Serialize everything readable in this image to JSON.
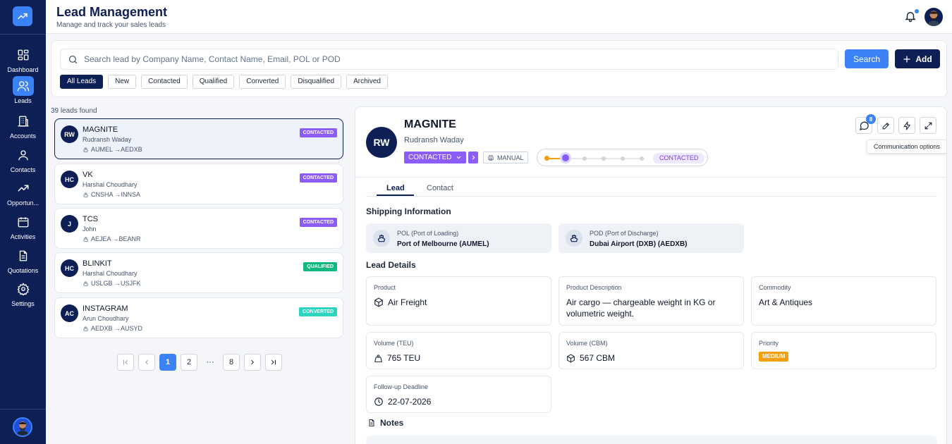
{
  "header": {
    "title": "Lead Management",
    "subtitle": "Manage and track your sales leads"
  },
  "sidebar": {
    "items": [
      {
        "label": "Dashboard",
        "icon": "dashboard-icon"
      },
      {
        "label": "Leads",
        "icon": "users-icon",
        "active": true
      },
      {
        "label": "Accounts",
        "icon": "building-icon"
      },
      {
        "label": "Contacts",
        "icon": "user-icon"
      },
      {
        "label": "Opportun...",
        "icon": "trending-up-icon"
      },
      {
        "label": "Activities",
        "icon": "calendar-icon"
      },
      {
        "label": "Quotations",
        "icon": "document-icon"
      },
      {
        "label": "Settings",
        "icon": "gear-icon"
      }
    ]
  },
  "search": {
    "placeholder": "Search lead by Company Name, Contact Name, Email, POL or POD",
    "value": "",
    "search_label": "Search",
    "add_label": "Add"
  },
  "filters": [
    "All Leads",
    "New",
    "Contacted",
    "Qualified",
    "Converted",
    "Disqualified",
    "Archived"
  ],
  "list": {
    "count_text": "39 leads found",
    "leads": [
      {
        "initials": "RW",
        "name": "MAGNITE",
        "contact": "Rudransh Waday",
        "route": "AUMEL →AEDXB",
        "status": "CONTACTED",
        "status_color": "#8b5cf6"
      },
      {
        "initials": "HC",
        "name": "VK",
        "contact": "Harshal Choudhary",
        "route": "CNSHA →INNSA",
        "status": "CONTACTED",
        "status_color": "#8b5cf6"
      },
      {
        "initials": "J",
        "name": "TCS",
        "contact": "John",
        "route": "AEJEA →BEANR",
        "status": "CONTACTED",
        "status_color": "#8b5cf6"
      },
      {
        "initials": "HC",
        "name": "BLINKIT",
        "contact": "Harshal Choudhary",
        "route": "USLGB →USJFK",
        "status": "QUALIFIED",
        "status_color": "#10b981"
      },
      {
        "initials": "AC",
        "name": "INSTAGRAM",
        "contact": "Arun Choudhary",
        "route": "AEDXB →AUSYD",
        "status": "CONVERTED",
        "status_color": "#2dd4bf"
      }
    ]
  },
  "pagination": {
    "current": "1",
    "page2": "2",
    "ellipsis": "···",
    "last": "8"
  },
  "detail": {
    "initials": "RW",
    "company": "MAGNITE",
    "contact": "Rudransh Waday",
    "status": "CONTACTED",
    "source": "MANUAL",
    "progress_label": "CONTACTED",
    "message_count": "8",
    "tooltip": "Communication options",
    "tabs": [
      "Lead",
      "Contact"
    ],
    "shipping_title": "Shipping Information",
    "pol_label": "POL (Port of Loading)",
    "pol_value": "Port of Melbourne (AUMEL)",
    "pod_label": "POD (Port of Discharge)",
    "pod_value": "Dubai Airport (DXB) (AEDXB)",
    "details_title": "Lead Details",
    "fields": {
      "product_label": "Product",
      "product_value": "Air Freight",
      "desc_label": "Product Description",
      "desc_value": "Air cargo — chargeable weight in KG or volumetric weight.",
      "commodity_label": "Commodity",
      "commodity_value": "Art & Antiques",
      "teu_label": "Volume (TEU)",
      "teu_value": "765 TEU",
      "cbm_label": "Volume (CBM)",
      "cbm_value": "567 CBM",
      "priority_label": "Priority",
      "priority_value": "MEDIUM",
      "deadline_label": "Follow-up Deadline",
      "deadline_value": "22-07-2026"
    },
    "notes_title": "Notes"
  },
  "colors": {
    "navy": "#0d1f55",
    "accent": "#3b82f6",
    "contacted": "#8b5cf6",
    "qualified": "#10b981",
    "converted": "#2dd4bf",
    "medium": "#f59e0b"
  }
}
